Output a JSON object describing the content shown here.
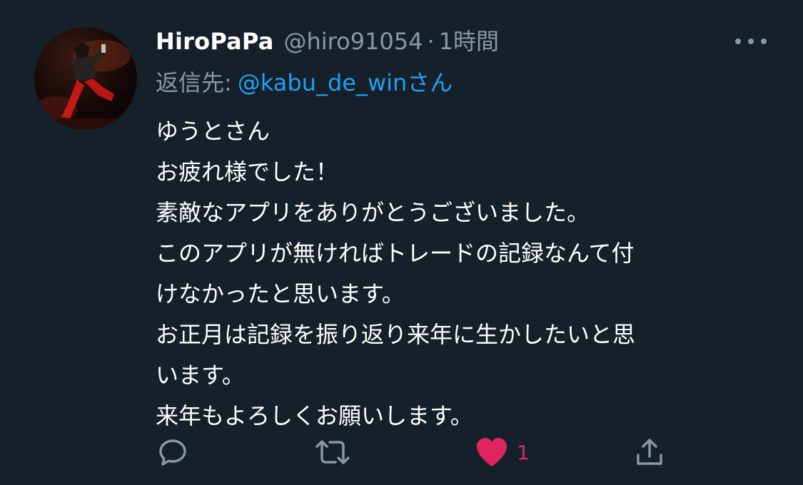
{
  "tweet": {
    "display_name": "HiroPaPa",
    "handle": "@hiro91054",
    "separator": "·",
    "timestamp": "1時間",
    "reply_prefix": "返信先:",
    "reply_mention": "@kabu_de_winさん",
    "body_lines": [
      "ゆうとさん",
      "お疲れ様でした！",
      "素敵なアプリをありがとうございました。",
      "このアプリが無ければトレードの記録なんて付",
      "けなかったと思います。",
      "お正月は記録を振り返り来年に生かしたいと思",
      "います。",
      "来年もよろしくお願いします。"
    ]
  },
  "actions": {
    "reply_icon": "reply-icon",
    "retweet_icon": "retweet-icon",
    "like_icon": "heart-icon",
    "like_count": "1",
    "share_icon": "share-icon"
  },
  "colors": {
    "background": "#15202b",
    "text": "#ffffff",
    "secondary": "#8899a6",
    "link": "#1da1f2",
    "like": "#e0245e"
  }
}
